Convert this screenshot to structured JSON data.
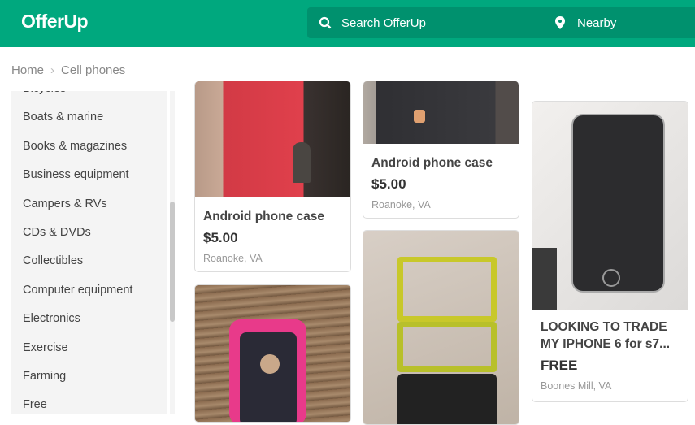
{
  "header": {
    "logo": "OfferUp",
    "search_placeholder": "Search OfferUp",
    "location": "Nearby",
    "color": "#00a87e"
  },
  "breadcrumb": [
    "Home",
    "Cell phones"
  ],
  "sidebar": {
    "items": [
      "Bicycles",
      "Boats & marine",
      "Books & magazines",
      "Business equipment",
      "Campers & RVs",
      "CDs & DVDs",
      "Collectibles",
      "Computer equipment",
      "Electronics",
      "Exercise",
      "Farming",
      "Free"
    ]
  },
  "listings": [
    {
      "title": "Android phone case",
      "price": "$5.00",
      "location": "Roanoke, VA"
    },
    {
      "title": "Android phone case",
      "price": "$5.00",
      "location": "Roanoke, VA"
    },
    {
      "title": "LOOKING TO TRADE MY IPHONE 6 for s7...",
      "price": "FREE",
      "location": "Boones Mill, VA"
    },
    {
      "title": "",
      "price": "",
      "location": ""
    },
    {
      "title": "",
      "price": "",
      "location": ""
    }
  ]
}
